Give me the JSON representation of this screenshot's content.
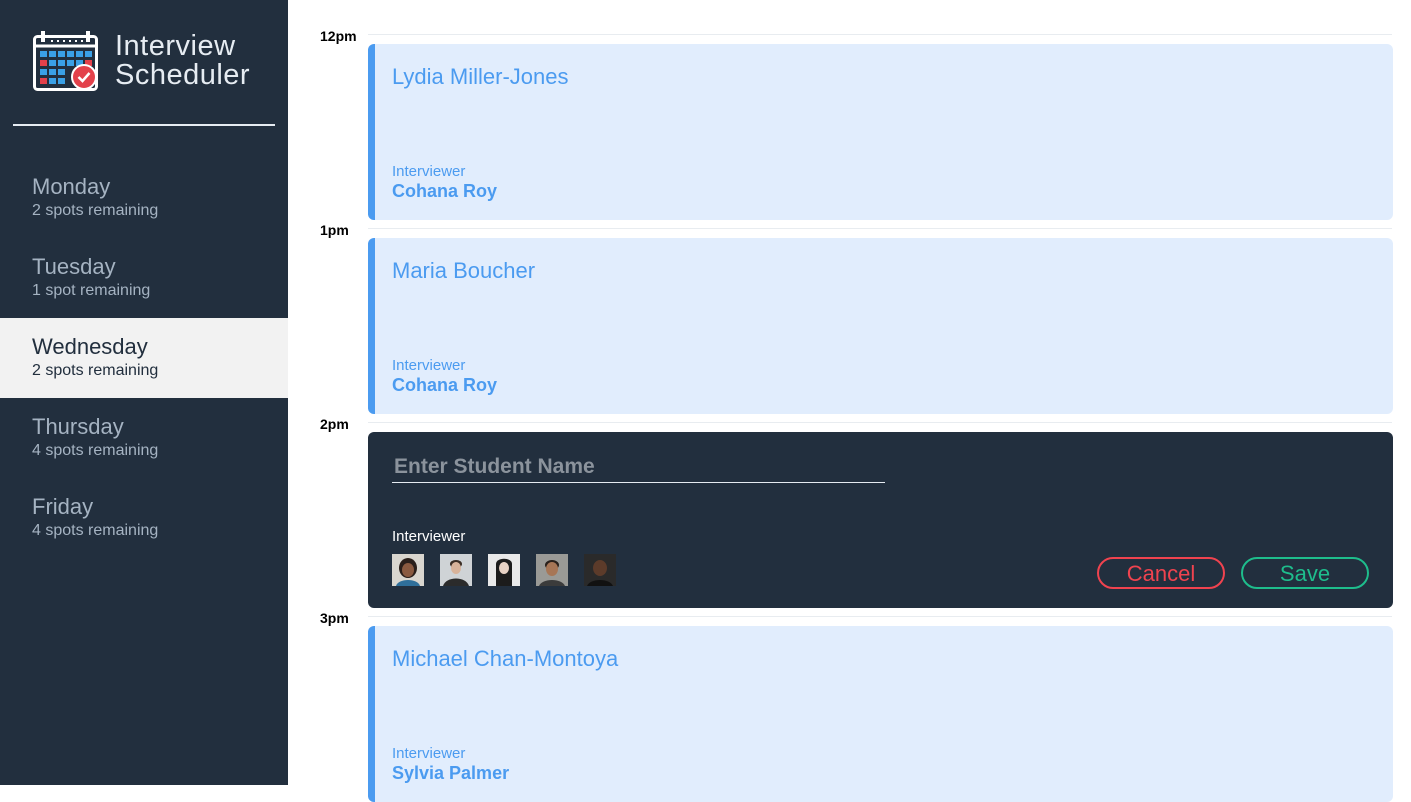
{
  "app": {
    "title_line1": "Interview",
    "title_line2": "Scheduler"
  },
  "days": [
    {
      "name": "Monday",
      "spots": "2 spots remaining",
      "selected": false
    },
    {
      "name": "Tuesday",
      "spots": "1 spot remaining",
      "selected": false
    },
    {
      "name": "Wednesday",
      "spots": "2 spots remaining",
      "selected": true
    },
    {
      "name": "Thursday",
      "spots": "4 spots remaining",
      "selected": false
    },
    {
      "name": "Friday",
      "spots": "4 spots remaining",
      "selected": false
    }
  ],
  "times": [
    "12pm",
    "1pm",
    "2pm",
    "3pm"
  ],
  "appointments": [
    {
      "student": "Lydia Miller-Jones",
      "interviewer_label": "Interviewer",
      "interviewer": "Cohana Roy"
    },
    {
      "student": "Maria Boucher",
      "interviewer_label": "Interviewer",
      "interviewer": "Cohana Roy"
    },
    {
      "student": "Michael Chan-Montoya",
      "interviewer_label": "Interviewer",
      "interviewer": "Sylvia Palmer"
    }
  ],
  "form": {
    "placeholder": "Enter Student Name",
    "value": "",
    "interviewer_label": "Interviewer",
    "cancel_label": "Cancel",
    "save_label": "Save"
  },
  "colors": {
    "sidebar_bg": "#222f3e",
    "accent_blue": "#4b9bf0",
    "appointment_bg": "#e1edfd",
    "danger": "#f0434f",
    "success": "#1ebd8c"
  }
}
